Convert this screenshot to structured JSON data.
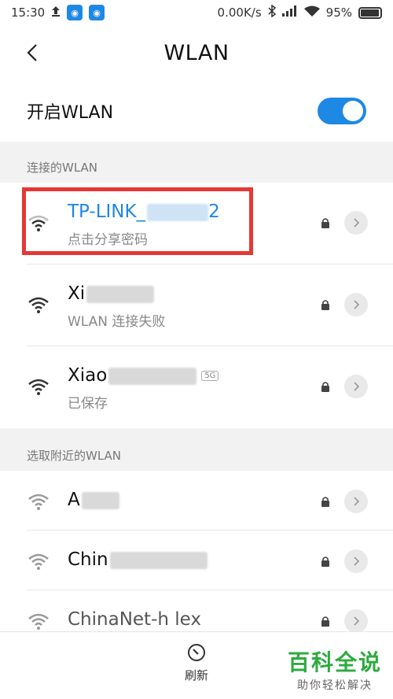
{
  "status_bar": {
    "time": "15:30",
    "network_speed": "0.00K/s",
    "battery": "95%",
    "battery_level": 0.95
  },
  "header": {
    "title": "WLAN"
  },
  "toggle": {
    "label": "开启WLAN",
    "enabled": true
  },
  "connected_section": {
    "title": "连接的WLAN",
    "networks": [
      {
        "name": "TP-LINK_",
        "name_suffix": "2",
        "status": "点击分享密码",
        "active": true
      }
    ]
  },
  "saved_networks": [
    {
      "name": "Xi",
      "status": "WLAN 连接失败"
    },
    {
      "name": "Xiao",
      "band": "5G",
      "status": "已保存"
    }
  ],
  "nearby_section": {
    "title": "选取附近的WLAN",
    "networks": [
      {
        "name": "A"
      },
      {
        "name": "Chin"
      },
      {
        "name": "ChinaNet-h lex"
      }
    ]
  },
  "bottom": {
    "refresh_label": "刷新"
  },
  "watermark": {
    "main": "百科全说",
    "sub": "助你轻松解决"
  },
  "colors": {
    "accent": "#1e88e5",
    "highlight": "#e53935",
    "watermark": "#2eaa3f"
  }
}
